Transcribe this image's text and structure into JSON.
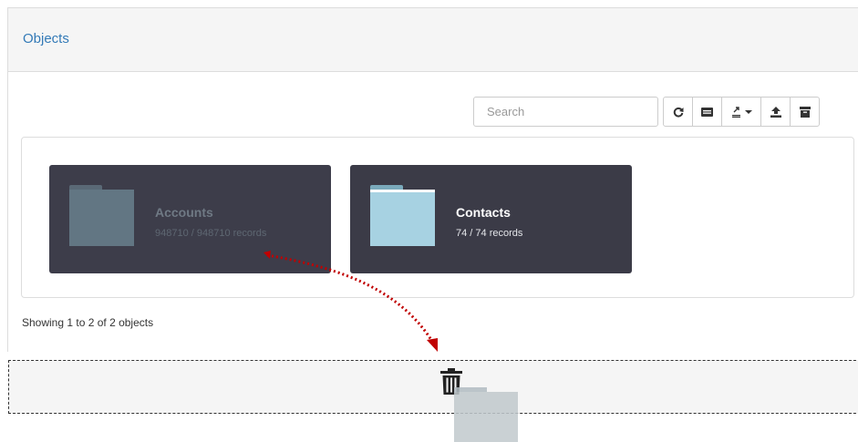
{
  "panel": {
    "title": "Objects"
  },
  "toolbar": {
    "search_placeholder": "Search",
    "buttons": [
      {
        "name": "refresh",
        "icon": "refresh-icon"
      },
      {
        "name": "columns",
        "icon": "columns-icon"
      },
      {
        "name": "export",
        "icon": "export-icon"
      },
      {
        "name": "upload",
        "icon": "upload-icon"
      },
      {
        "name": "archive",
        "icon": "archive-icon"
      }
    ]
  },
  "objects": [
    {
      "name": "Accounts",
      "records": "948710 / 948710 records",
      "state": "dragging"
    },
    {
      "name": "Contacts",
      "records": "74 / 74 records",
      "state": "normal"
    }
  ],
  "pagination": {
    "summary": "Showing 1 to 2 of 2 objects"
  },
  "drop_zone": {
    "icon": "trash-icon"
  },
  "colors": {
    "title_link": "#337ab7",
    "card_bg": "#3b3b47",
    "folder_light": "#a7d2e2",
    "folder_dim": "#627683",
    "drag_arrow": "#c00000"
  }
}
